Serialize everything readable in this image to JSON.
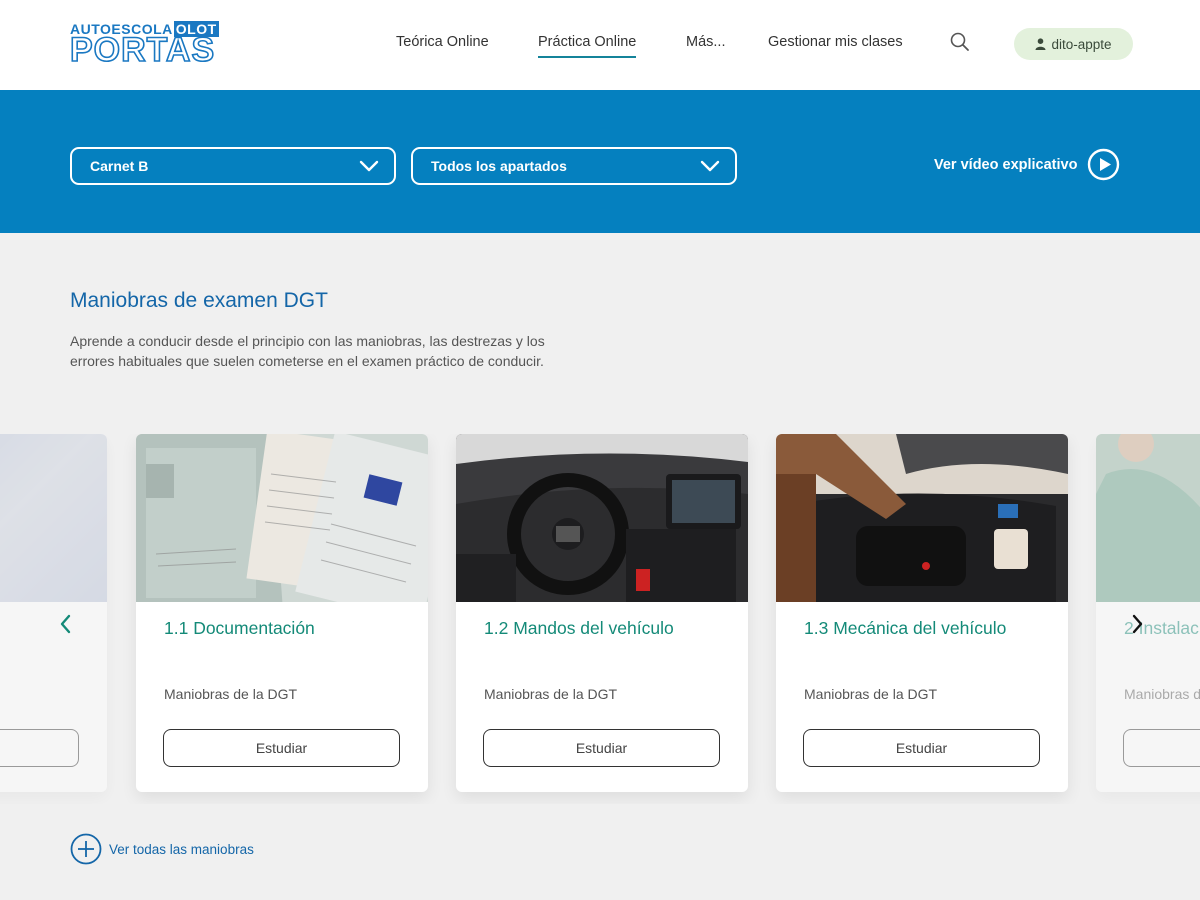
{
  "header": {
    "logo": {
      "top": "AUTOESCOLA",
      "top_badge": "OLOT",
      "main": "PORTAS"
    },
    "nav": [
      {
        "label": "Teórica Online",
        "active": false
      },
      {
        "label": "Práctica Online",
        "active": true
      },
      {
        "label": "Más...",
        "active": false
      },
      {
        "label": "Gestionar mis clases",
        "active": false
      }
    ],
    "search_icon": "search-icon",
    "user": {
      "icon": "user-icon",
      "label": "dito-appte"
    }
  },
  "banner": {
    "filters": [
      {
        "selected": "Carnet B",
        "icon": "chevron-down-icon"
      },
      {
        "selected": "Todos los apartados",
        "icon": "chevron-down-icon"
      }
    ],
    "video_link": {
      "label": "Ver vídeo explicativo",
      "icon": "play-circle-icon"
    }
  },
  "section": {
    "title": "Maniobras de examen DGT",
    "description": "Aprende a conducir desde el principio con las maniobras, las destrezas y los errores habituales que suelen cometerse en el examen práctico de conducir."
  },
  "carousel": {
    "prev_icon": "chevron-left-icon",
    "next_icon": "chevron-right-icon",
    "cards": [
      {
        "title": "",
        "subtitle": "",
        "button": "",
        "image": "gradient-image"
      },
      {
        "title": "1.1 Documentación",
        "subtitle": "Maniobras de la DGT",
        "button": "Estudiar",
        "image": "vehicle-documents-image"
      },
      {
        "title": "1.2 Mandos del vehículo",
        "subtitle": "Maniobras de la DGT",
        "button": "Estudiar",
        "image": "car-dashboard-image"
      },
      {
        "title": "1.3 Mecánica del vehículo",
        "subtitle": "Maniobras de la DGT",
        "button": "Estudiar",
        "image": "car-engine-image"
      },
      {
        "title": "2 Instalac",
        "subtitle": "Maniobras d",
        "button": "",
        "image": "driver-image"
      }
    ]
  },
  "see_all": {
    "label": "Ver todas las maniobras",
    "icon": "plus-circle-icon"
  },
  "colors": {
    "primary_blue": "#0580bf",
    "title_blue": "#1466a8",
    "teal": "#148a78",
    "user_pill_bg": "#e3f1dc",
    "page_bg": "#f0f0f0"
  }
}
